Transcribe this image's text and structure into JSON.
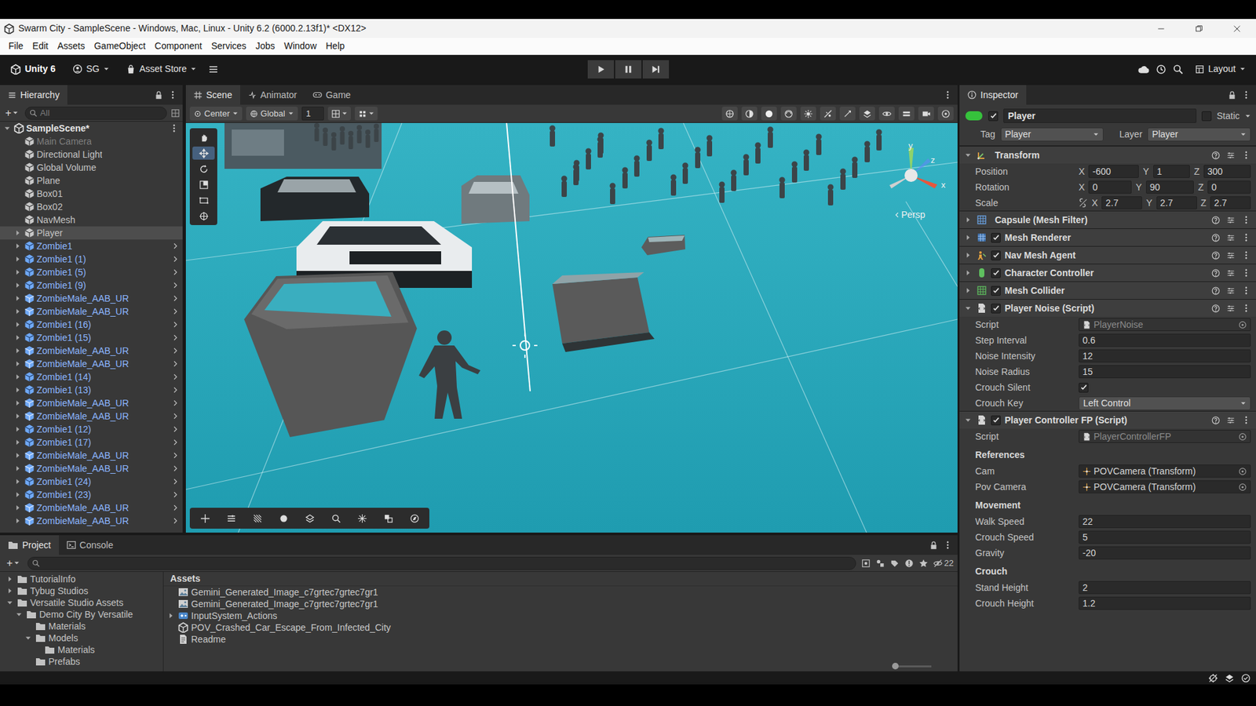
{
  "window": {
    "title": "Swarm City - SampleScene - Windows, Mac, Linux - Unity 6.2 (6000.2.13f1)* <DX12>"
  },
  "menu": [
    "File",
    "Edit",
    "Assets",
    "GameObject",
    "Component",
    "Services",
    "Jobs",
    "Window",
    "Help"
  ],
  "toolbar": {
    "editor_label": "Unity 6",
    "account": "SG",
    "store": "Asset Store",
    "layout": "Layout",
    "playing": false,
    "paused": false
  },
  "hierarchy": {
    "title": "Hierarchy",
    "add_button": "+",
    "search_placeholder": "All",
    "items": [
      {
        "label": "SampleScene*",
        "kind": "scene",
        "selected": false,
        "disabled": false,
        "foldout": "open"
      },
      {
        "label": "Main Camera",
        "kind": "object",
        "selected": false,
        "disabled": true,
        "foldout": "none"
      },
      {
        "label": "Directional Light",
        "kind": "object",
        "selected": false,
        "disabled": false,
        "foldout": "none"
      },
      {
        "label": "Global Volume",
        "kind": "object",
        "selected": false,
        "disabled": false,
        "foldout": "none"
      },
      {
        "label": "Plane",
        "kind": "object",
        "selected": false,
        "disabled": false,
        "foldout": "none"
      },
      {
        "label": "Box01",
        "kind": "object",
        "selected": false,
        "disabled": false,
        "foldout": "none"
      },
      {
        "label": "Box02",
        "kind": "object",
        "selected": false,
        "disabled": false,
        "foldout": "none"
      },
      {
        "label": "NavMesh",
        "kind": "object",
        "selected": false,
        "disabled": false,
        "foldout": "none"
      },
      {
        "label": "Player",
        "kind": "object",
        "selected": true,
        "disabled": false,
        "foldout": "closed"
      },
      {
        "label": "Zombie1",
        "kind": "prefab",
        "selected": false,
        "disabled": false,
        "foldout": "closed"
      },
      {
        "label": "Zombie1 (1)",
        "kind": "prefab",
        "selected": false,
        "disabled": false,
        "foldout": "closed"
      },
      {
        "label": "Zombie1 (5)",
        "kind": "prefab",
        "selected": false,
        "disabled": false,
        "foldout": "closed"
      },
      {
        "label": "Zombie1 (9)",
        "kind": "prefab",
        "selected": false,
        "disabled": false,
        "foldout": "closed"
      },
      {
        "label": "ZombieMale_AAB_UR",
        "kind": "model",
        "selected": false,
        "disabled": false,
        "foldout": "closed"
      },
      {
        "label": "ZombieMale_AAB_UR",
        "kind": "model",
        "selected": false,
        "disabled": false,
        "foldout": "closed"
      },
      {
        "label": "Zombie1 (16)",
        "kind": "prefab",
        "selected": false,
        "disabled": false,
        "foldout": "closed"
      },
      {
        "label": "Zombie1 (15)",
        "kind": "prefab",
        "selected": false,
        "disabled": false,
        "foldout": "closed"
      },
      {
        "label": "ZombieMale_AAB_UR",
        "kind": "model",
        "selected": false,
        "disabled": false,
        "foldout": "closed"
      },
      {
        "label": "ZombieMale_AAB_UR",
        "kind": "model",
        "selected": false,
        "disabled": false,
        "foldout": "closed"
      },
      {
        "label": "Zombie1 (14)",
        "kind": "prefab",
        "selected": false,
        "disabled": false,
        "foldout": "closed"
      },
      {
        "label": "Zombie1 (13)",
        "kind": "prefab",
        "selected": false,
        "disabled": false,
        "foldout": "closed"
      },
      {
        "label": "ZombieMale_AAB_UR",
        "kind": "model",
        "selected": false,
        "disabled": false,
        "foldout": "closed"
      },
      {
        "label": "ZombieMale_AAB_UR",
        "kind": "model",
        "selected": false,
        "disabled": false,
        "foldout": "closed"
      },
      {
        "label": "Zombie1 (12)",
        "kind": "prefab",
        "selected": false,
        "disabled": false,
        "foldout": "closed"
      },
      {
        "label": "Zombie1 (17)",
        "kind": "prefab",
        "selected": false,
        "disabled": false,
        "foldout": "closed"
      },
      {
        "label": "ZombieMale_AAB_UR",
        "kind": "model",
        "selected": false,
        "disabled": false,
        "foldout": "closed"
      },
      {
        "label": "ZombieMale_AAB_UR",
        "kind": "model",
        "selected": false,
        "disabled": false,
        "foldout": "closed"
      },
      {
        "label": "Zombie1 (24)",
        "kind": "prefab",
        "selected": false,
        "disabled": false,
        "foldout": "closed"
      },
      {
        "label": "Zombie1 (23)",
        "kind": "prefab",
        "selected": false,
        "disabled": false,
        "foldout": "closed"
      },
      {
        "label": "ZombieMale_AAB_UR",
        "kind": "model",
        "selected": false,
        "disabled": false,
        "foldout": "closed"
      },
      {
        "label": "ZombieMale_AAB_UR",
        "kind": "model",
        "selected": false,
        "disabled": false,
        "foldout": "closed"
      }
    ]
  },
  "scene_tabs": [
    {
      "label": "Scene",
      "selected": true
    },
    {
      "label": "Animator",
      "selected": false
    },
    {
      "label": "Game",
      "selected": false
    }
  ],
  "scene_toolbar": {
    "pivot": "Center",
    "space": "Global",
    "grid": "1"
  },
  "scene": {
    "projection": "Persp",
    "gizmo_axes": [
      "y",
      "z",
      "x"
    ]
  },
  "inspector": {
    "title": "Inspector",
    "object": {
      "name": "Player",
      "active": true,
      "static_label": "Static",
      "static": false,
      "tag_label": "Tag",
      "tag": "Player",
      "layer_label": "Layer",
      "layer": "Player"
    },
    "components": [
      {
        "name": "Transform",
        "kind": "transform",
        "toggle": "none",
        "expanded": true,
        "fields": [
          {
            "kind": "vector3",
            "label": "Position",
            "values": [
              {
                "axis": "X",
                "value": "-600"
              },
              {
                "axis": "Y",
                "value": "1"
              },
              {
                "axis": "Z",
                "value": "300"
              }
            ]
          },
          {
            "kind": "vector3",
            "label": "Rotation",
            "values": [
              {
                "axis": "X",
                "value": "0"
              },
              {
                "axis": "Y",
                "value": "90"
              },
              {
                "axis": "Z",
                "value": "0"
              }
            ]
          },
          {
            "kind": "scale",
            "label": "Scale",
            "values": [
              {
                "axis": "X",
                "value": "2.7"
              },
              {
                "axis": "Y",
                "value": "2.7"
              },
              {
                "axis": "Z",
                "value": "2.7"
              }
            ]
          }
        ]
      },
      {
        "name": "Capsule (Mesh Filter)",
        "kind": "meshfilter",
        "toggle": "none",
        "expanded": false,
        "fields": []
      },
      {
        "name": "Mesh Renderer",
        "kind": "renderer",
        "toggle": "on",
        "expanded": false,
        "fields": []
      },
      {
        "name": "Nav Mesh Agent",
        "kind": "agent",
        "toggle": "on",
        "expanded": false,
        "fields": []
      },
      {
        "name": "Character Controller",
        "kind": "controller",
        "toggle": "on",
        "expanded": false,
        "fields": []
      },
      {
        "name": "Mesh Collider",
        "kind": "collider",
        "toggle": "on",
        "expanded": false,
        "fields": []
      },
      {
        "name": "Player Noise (Script)",
        "kind": "script",
        "toggle": "on",
        "expanded": true,
        "fields": [
          {
            "kind": "script",
            "label": "Script",
            "value": "PlayerNoise"
          },
          {
            "kind": "text",
            "label": "Step Interval",
            "value": "0.6"
          },
          {
            "kind": "text",
            "label": "Noise Intensity",
            "value": "12"
          },
          {
            "kind": "text",
            "label": "Noise Radius",
            "value": "15"
          },
          {
            "kind": "checkbox",
            "label": "Crouch Silent",
            "checked": true
          },
          {
            "kind": "dropdown",
            "label": "Crouch Key",
            "value": "Left Control"
          }
        ]
      },
      {
        "name": "Player Controller FP (Script)",
        "kind": "script",
        "toggle": "on",
        "expanded": true,
        "fields": [
          {
            "kind": "script",
            "label": "Script",
            "value": "PlayerControllerFP"
          },
          {
            "kind": "header",
            "label": "References"
          },
          {
            "kind": "object",
            "label": "Cam",
            "value": "POVCamera (Transform)"
          },
          {
            "kind": "object",
            "label": "Pov Camera",
            "value": "POVCamera (Transform)"
          },
          {
            "kind": "header",
            "label": "Movement"
          },
          {
            "kind": "text",
            "label": "Walk Speed",
            "value": "22"
          },
          {
            "kind": "text",
            "label": "Crouch Speed",
            "value": "5"
          },
          {
            "kind": "text",
            "label": "Gravity",
            "value": "-20"
          },
          {
            "kind": "header",
            "label": "Crouch"
          },
          {
            "kind": "text",
            "label": "Stand Height",
            "value": "2"
          },
          {
            "kind": "text",
            "label": "Crouch Height",
            "value": "1.2"
          }
        ]
      }
    ]
  },
  "project": {
    "tabs": [
      {
        "label": "Project",
        "selected": true
      },
      {
        "label": "Console",
        "selected": false
      }
    ],
    "add_button": "+",
    "hidden_count": "22",
    "tree": [
      {
        "label": "TutorialInfo",
        "depth": 0,
        "foldout": "closed"
      },
      {
        "label": "Tybug Studios",
        "depth": 0,
        "foldout": "closed"
      },
      {
        "label": "Versatile Studio Assets",
        "depth": 0,
        "foldout": "open"
      },
      {
        "label": "Demo City By Versatile",
        "depth": 1,
        "foldout": "open"
      },
      {
        "label": "Materials",
        "depth": 2,
        "foldout": "none"
      },
      {
        "label": "Models",
        "depth": 2,
        "foldout": "open"
      },
      {
        "label": "Materials",
        "depth": 3,
        "foldout": "none"
      },
      {
        "label": "Prefabs",
        "depth": 2,
        "foldout": "none"
      }
    ],
    "breadcrumb": "Assets",
    "assets": [
      {
        "name": "Gemini_Generated_Image_c7grtec7grtec7gr1",
        "kind": "image",
        "foldout": "none"
      },
      {
        "name": "Gemini_Generated_Image_c7grtec7grtec7gr1",
        "kind": "image",
        "foldout": "none"
      },
      {
        "name": "InputSystem_Actions",
        "kind": "input",
        "foldout": "closed"
      },
      {
        "name": "POV_Crashed_Car_Escape_From_Infected_City",
        "kind": "scene",
        "foldout": "none"
      },
      {
        "name": "Readme",
        "kind": "text",
        "foldout": "none"
      }
    ]
  }
}
